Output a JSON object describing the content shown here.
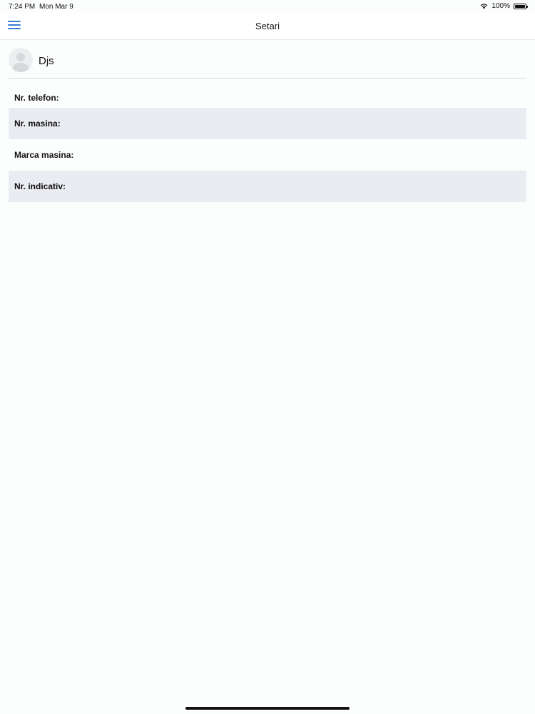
{
  "status_bar": {
    "time": "7:24 PM",
    "date": "Mon Mar 9",
    "battery": "100%",
    "icons": [
      "wifi-icon",
      "battery-icon"
    ]
  },
  "nav": {
    "title": "Setari",
    "menu_icon": "hamburger-menu-icon",
    "accent_color": "#3a7bd5"
  },
  "profile": {
    "name": "Djs",
    "avatar_icon": "person-silhouette-icon"
  },
  "fields": [
    {
      "label": "Nr. telefon:"
    },
    {
      "label": "Nr. masina:"
    },
    {
      "label": "Marca masina:"
    },
    {
      "label": "Nr. indicativ:"
    }
  ],
  "colors": {
    "alt_row": "#eaecf2",
    "background": "#fcfdfd"
  }
}
